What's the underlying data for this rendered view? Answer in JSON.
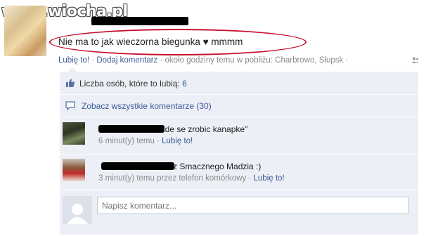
{
  "watermark": "www.wiocha.pl",
  "status": {
    "text": "Nie ma to jak wieczorna biegunka ♥ mmmm"
  },
  "post_meta": {
    "like": "Lubię to!",
    "sep1": " · ",
    "comment": "Dodaj komentarz",
    "sep2": " · ",
    "location": "około godziny temu w pobliżu: Charbrowo, Słupsk",
    "sep3": " · "
  },
  "likes": {
    "label": "Liczba osób, które to lubią:",
    "count": "6"
  },
  "view_all": "Zobacz wszystkie komentarze (30)",
  "comments": [
    {
      "text": "ide se zrobic kanapke\"",
      "time": "6 minut(y) temu",
      "sep": " · ",
      "like": "Lubię to!"
    },
    {
      "text": "z Smacznego Madzia :)",
      "time": "3 minut(y) temu przez telefon komórkowy",
      "sep": " · ",
      "like": "Lubię to!"
    }
  ],
  "new_comment": {
    "placeholder": "Napisz komentarz..."
  },
  "colors": {
    "link": "#3b5998",
    "highlight_oval": "#c8102e",
    "comments_bg": "#eceff5"
  },
  "icons": [
    "thumbs-up-icon",
    "comment-bubble-icon",
    "friends-icon"
  ]
}
